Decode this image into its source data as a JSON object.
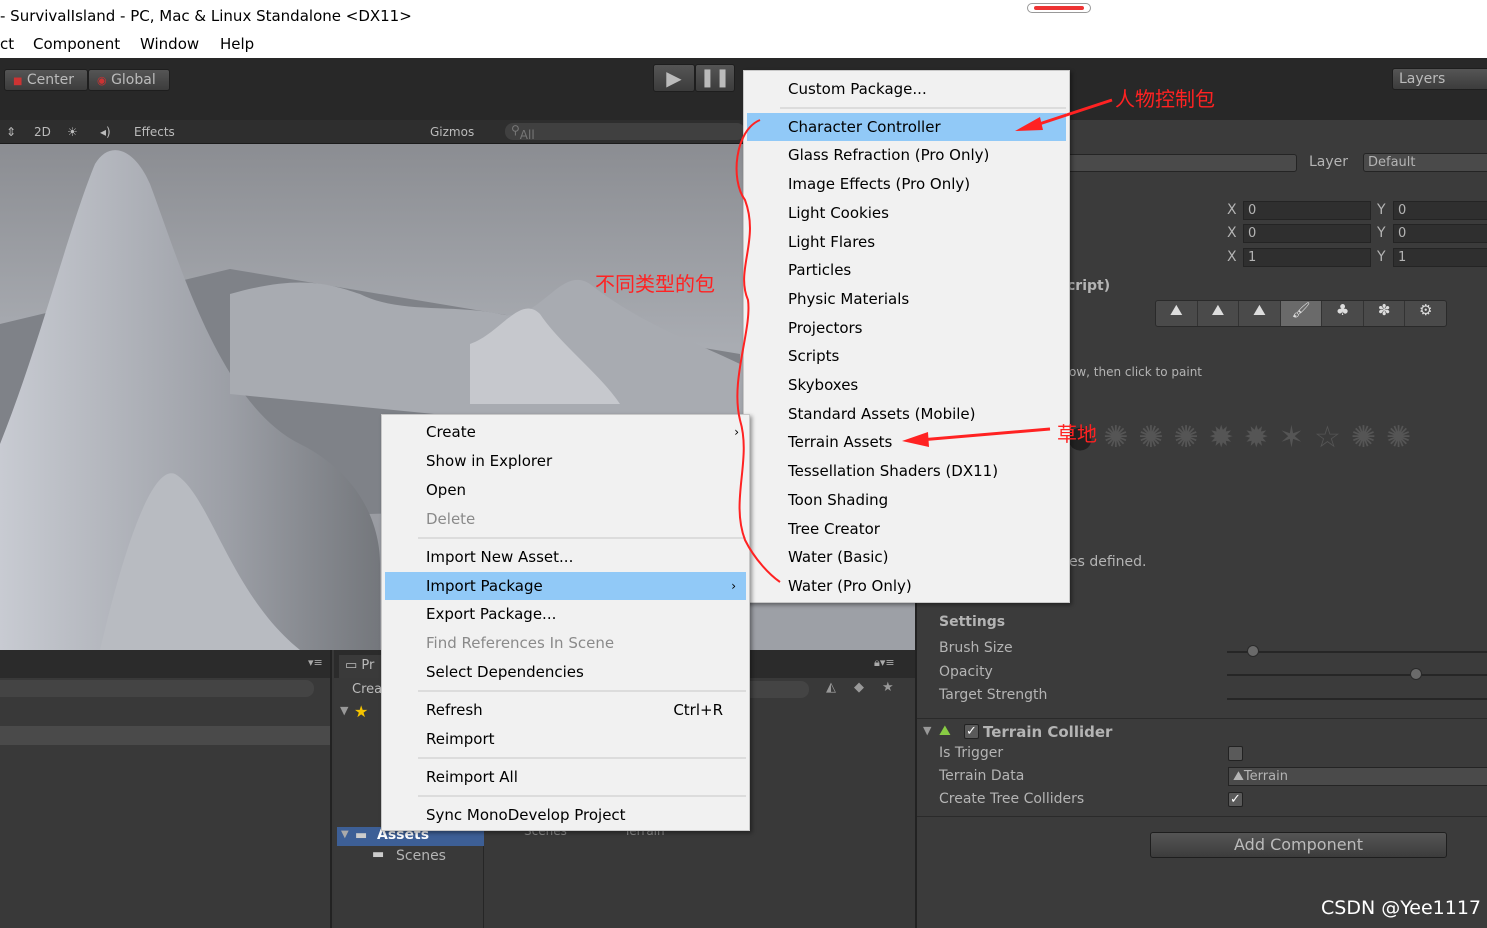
{
  "window": {
    "title": "- SurvivalIsland - PC, Mac & Linux Standalone <DX11>"
  },
  "menubar": [
    "ct",
    "Component",
    "Window",
    "Help"
  ],
  "toolbar": {
    "center": "Center",
    "global": "Global",
    "layers": "Layers",
    "play_icon": "play-icon",
    "pause_icon": "pause-icon"
  },
  "scene_header": {
    "mode_2d": "2D",
    "effects": "Effects",
    "gizmos": "Gizmos",
    "search_placeholder": "All"
  },
  "project": {
    "tab": "Pr",
    "create": "Crea",
    "assets": "Assets",
    "scenes": "Scenes",
    "grid_items": [
      "Scenes",
      "Terrain"
    ]
  },
  "inspector": {
    "layer_label": "Layer",
    "layer_value": "Default",
    "rows": [
      {
        "x": "0",
        "y": "0"
      },
      {
        "x": "0",
        "y": "0"
      },
      {
        "x": "1",
        "y": "1"
      }
    ],
    "script_title": "cript)",
    "hint": "ow, then click to paint",
    "no_defined": "es defined.",
    "settings": "Settings",
    "brush_size": "Brush Size",
    "opacity": "Opacity",
    "target_strength": "Target Strength",
    "slider_values": {
      "brush_size": 0.1,
      "opacity": 0.72,
      "target_strength": null
    },
    "collider_title": "Terrain Collider",
    "is_trigger": "Is Trigger",
    "terrain_data": "Terrain Data",
    "terrain_data_value": "Terrain",
    "create_tree_colliders": "Create Tree Colliders",
    "is_trigger_checked": false,
    "create_tree_checked": true,
    "add_component": "Add Component"
  },
  "context_menu": {
    "items": [
      {
        "label": "Create",
        "submenu": true
      },
      {
        "label": "Show in Explorer"
      },
      {
        "label": "Open"
      },
      {
        "label": "Delete",
        "disabled": true
      },
      {
        "sep": true
      },
      {
        "label": "Import New Asset..."
      },
      {
        "label": "Import Package",
        "submenu": true,
        "highlight": true
      },
      {
        "label": "Export Package..."
      },
      {
        "label": "Find References In Scene",
        "disabled": true
      },
      {
        "label": "Select Dependencies"
      },
      {
        "sep": true
      },
      {
        "label": "Refresh",
        "shortcut": "Ctrl+R"
      },
      {
        "label": "Reimport"
      },
      {
        "sep": true
      },
      {
        "label": "Reimport All"
      },
      {
        "sep": true
      },
      {
        "label": "Sync MonoDevelop Project"
      }
    ]
  },
  "submenu": {
    "items": [
      {
        "label": "Custom Package..."
      },
      {
        "sep": true
      },
      {
        "label": "Character Controller",
        "highlight": true
      },
      {
        "label": "Glass Refraction (Pro Only)"
      },
      {
        "label": "Image Effects (Pro Only)"
      },
      {
        "label": "Light Cookies"
      },
      {
        "label": "Light Flares"
      },
      {
        "label": "Particles"
      },
      {
        "label": "Physic Materials"
      },
      {
        "label": "Projectors"
      },
      {
        "label": "Scripts"
      },
      {
        "label": "Skyboxes"
      },
      {
        "label": "Standard Assets (Mobile)"
      },
      {
        "label": "Terrain Assets"
      },
      {
        "label": "Tessellation Shaders (DX11)"
      },
      {
        "label": "Toon Shading"
      },
      {
        "label": "Tree Creator"
      },
      {
        "label": "Water (Basic)"
      },
      {
        "label": "Water (Pro Only)"
      }
    ]
  },
  "annotations": {
    "character": "人物控制包",
    "types": "不同类型的包",
    "grass": "草地",
    "color": "#ff2222"
  },
  "watermark": "CSDN @Yee1117"
}
